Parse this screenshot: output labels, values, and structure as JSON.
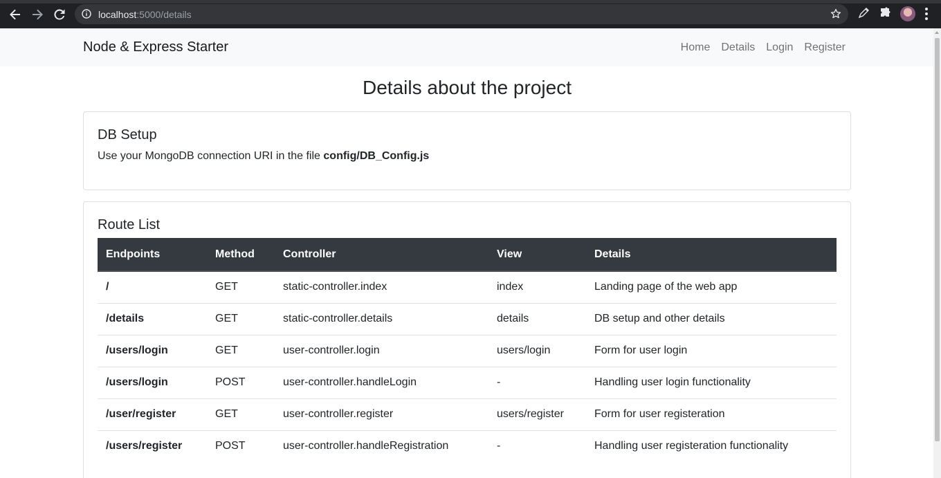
{
  "browser": {
    "url_host": "localhost",
    "url_path": ":5000/details"
  },
  "navbar": {
    "brand": "Node & Express Starter",
    "links": [
      "Home",
      "Details",
      "Login",
      "Register"
    ]
  },
  "page": {
    "title": "Details about the project"
  },
  "db_card": {
    "title": "DB Setup",
    "text_prefix": "Use your MongoDB connection URI in the file ",
    "file": "config/DB_Config.js"
  },
  "routes_card": {
    "title": "Route List",
    "headers": [
      "Endpoints",
      "Method",
      "Controller",
      "View",
      "Details"
    ],
    "rows": [
      [
        "/",
        "GET",
        "static-controller.index",
        "index",
        "Landing page of the web app"
      ],
      [
        "/details",
        "GET",
        "static-controller.details",
        "details",
        "DB setup and other details"
      ],
      [
        "/users/login",
        "GET",
        "user-controller.login",
        "users/login",
        "Form for user login"
      ],
      [
        "/users/login",
        "POST",
        "user-controller.handleLogin",
        "-",
        "Handling user login functionality"
      ],
      [
        "/user/register",
        "GET",
        "user-controller.register",
        "users/register",
        "Form for user registeration"
      ],
      [
        "/users/register",
        "POST",
        "user-controller.handleRegistration",
        "-",
        "Handling user registeration functionality"
      ]
    ]
  },
  "icons": {
    "back": "back-arrow-icon",
    "forward": "forward-arrow-icon",
    "reload": "reload-icon",
    "info": "info-icon",
    "star": "star-icon",
    "pen": "pen-extension-icon",
    "puzzle": "puzzle-extension-icon",
    "menu": "kebab-menu-icon"
  }
}
